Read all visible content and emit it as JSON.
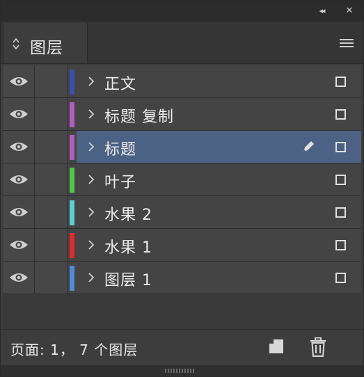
{
  "panel": {
    "tab_label": "图层",
    "status_text": "页面: 1， 7 个图层"
  },
  "titlebar": {
    "collapse_glyph": "◂◂",
    "close_glyph": "✕"
  },
  "layers": [
    {
      "name": "正文",
      "color": "#3a4fb0",
      "visible": true,
      "selected": false
    },
    {
      "name": "标题 复制",
      "color": "#b05cc0",
      "visible": true,
      "selected": false
    },
    {
      "name": "标题",
      "color": "#b05cc0",
      "visible": true,
      "selected": true,
      "editing_icon": "pen-icon"
    },
    {
      "name": "叶子",
      "color": "#4fc84a",
      "visible": true,
      "selected": false
    },
    {
      "name": "水果 2",
      "color": "#5ccfcf",
      "visible": true,
      "selected": false
    },
    {
      "name": "水果 1",
      "color": "#e02b2b",
      "visible": true,
      "selected": false
    },
    {
      "name": "图层 1",
      "color": "#4f8ad4",
      "visible": true,
      "selected": false
    }
  ],
  "icons": {
    "visibility": "eye-icon",
    "expand": "chevron-right-icon",
    "target": "target-square-icon",
    "menu": "hamburger-menu-icon",
    "new_layer": "new-layer-icon",
    "delete": "trash-icon",
    "tab_arrows": "up-down-arrows-icon"
  },
  "colors": {
    "selection": "#4b6284",
    "panel_bg": "#3d3d3d",
    "row_bg": "#444444"
  }
}
